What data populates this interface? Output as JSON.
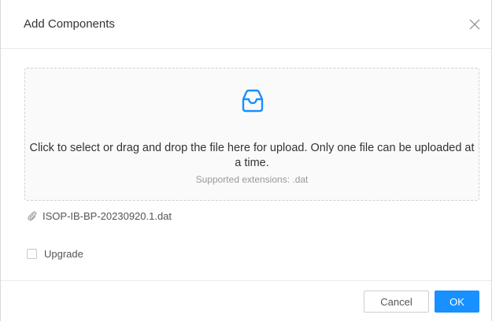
{
  "dialog": {
    "title": "Add Components",
    "close_icon": "close-icon"
  },
  "upload": {
    "icon": "inbox-icon",
    "accent_color": "#1890ff",
    "main_text": "Click to select or drag and drop the file here for upload. Only one file can be uploaded at a time.",
    "hint_text": "Supported extensions: .dat"
  },
  "file": {
    "icon": "paperclip-icon",
    "name": "ISOP-IB-BP-20230920.1.dat"
  },
  "options": {
    "upgrade_label": "Upgrade",
    "upgrade_checked": false
  },
  "footer": {
    "cancel_label": "Cancel",
    "ok_label": "OK",
    "ok_color": "#1890ff"
  }
}
